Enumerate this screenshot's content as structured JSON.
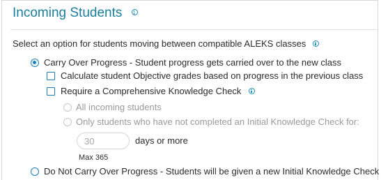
{
  "section": {
    "title": "Incoming Students"
  },
  "prompt": {
    "text": "Select an option for students moving between compatible ALEKS classes"
  },
  "options": {
    "carry_over": {
      "label": "Carry Over Progress - Student progress gets carried over to the new class",
      "selected": true
    },
    "calc_objective": {
      "label": "Calculate student Objective grades based on progress in the previous class",
      "checked": false
    },
    "require_check": {
      "label": "Require a Comprehensive Knowledge Check",
      "checked": false
    },
    "all_incoming": {
      "label": "All incoming students",
      "selected": false,
      "disabled": true
    },
    "only_students": {
      "label": "Only students who have not completed an Initial Knowledge Check for:",
      "selected": false,
      "disabled": true
    },
    "days": {
      "placeholder": "30",
      "value": "",
      "suffix": "days or more",
      "max_label": "Max 365"
    },
    "do_not_carry": {
      "label": "Do Not Carry Over Progress - Students will be given a new Initial Knowledge Check",
      "selected": false
    }
  },
  "colors": {
    "title": "#1a7f9b",
    "accent": "#1a7fb8",
    "muted": "#9a9a9a",
    "text": "#2b2b2b"
  }
}
